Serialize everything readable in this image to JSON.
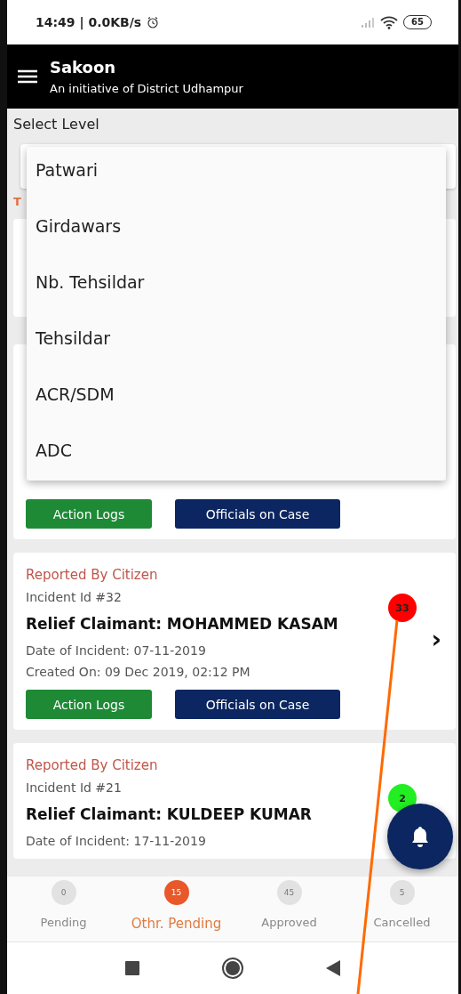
{
  "status_bar": {
    "text": "14:49 | 0.0KB/s",
    "battery": "65"
  },
  "app_bar": {
    "title": "Sakoon",
    "subtitle": "An initiative of District Udhampur"
  },
  "select_level": {
    "label": "Select Level",
    "covered_text": "T",
    "menu": [
      {
        "label": "Patwari"
      },
      {
        "label": "Girdawars"
      },
      {
        "label": "Nb. Tehsildar"
      },
      {
        "label": "Tehsildar"
      },
      {
        "label": "ACR/SDM"
      },
      {
        "label": "ADC"
      }
    ]
  },
  "cases": [
    {
      "actions": [
        {
          "kind": "logs",
          "label": "Action Logs"
        },
        {
          "kind": "officials",
          "label": "Officials on Case"
        }
      ]
    },
    {
      "reporter": "Reported By Citizen",
      "incident_id": "Incident Id #32",
      "claimant": "Relief Claimant: MOHAMMED KASAM",
      "date": "Date of Incident: 07-11-2019",
      "created": "Created On: 09 Dec 2019, 02:12 PM",
      "count": "33",
      "color": "#ff0000",
      "chevron": "›",
      "actions": [
        {
          "kind": "logs",
          "label": "Action Logs"
        },
        {
          "kind": "officials",
          "label": "Officials on Case"
        }
      ]
    },
    {
      "reporter": "Reported By Citizen",
      "incident_id": "Incident Id #21",
      "claimant": "Relief Claimant: KULDEEP KUMAR",
      "date": "Date of Incident: 17-11-2019",
      "count": "2",
      "color": "#22ee22"
    }
  ],
  "tabs": [
    {
      "label": "Pending",
      "count": "0",
      "selected": false
    },
    {
      "label": "Othr. Pending",
      "count": "15",
      "selected": true
    },
    {
      "label": "Approved",
      "count": "45",
      "selected": false
    },
    {
      "label": "Cancelled",
      "count": "5",
      "selected": false
    }
  ]
}
